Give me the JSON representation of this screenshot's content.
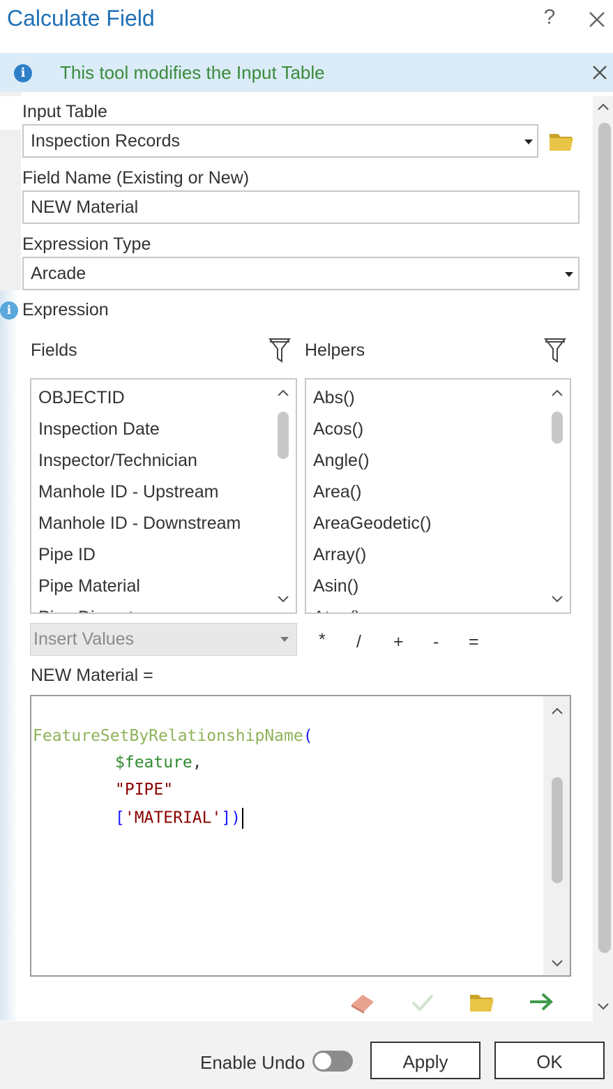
{
  "window": {
    "title": "Calculate Field",
    "help_label": "?"
  },
  "banner": {
    "text": "This tool modifies the Input Table",
    "icon": "info-icon"
  },
  "input_table": {
    "label": "Input Table",
    "value": "Inspection Records"
  },
  "field_name": {
    "label": "Field Name (Existing or New)",
    "value": "NEW Material"
  },
  "expression_type": {
    "label": "Expression Type",
    "value": "Arcade"
  },
  "expression": {
    "label": "Expression",
    "fields_label": "Fields",
    "helpers_label": "Helpers",
    "fields": [
      "OBJECTID",
      "Inspection Date",
      "Inspector/Technician",
      "Manhole ID - Upstream",
      "Manhole ID - Downstream",
      "Pipe ID",
      "Pipe Material",
      "Pipe Diameter"
    ],
    "helpers": [
      "Abs()",
      "Acos()",
      "Angle()",
      "Area()",
      "AreaGeodetic()",
      "Array()",
      "Asin()",
      "Atan()"
    ],
    "insert_values_placeholder": "Insert Values",
    "operators": [
      "*",
      "/",
      "+",
      "-",
      "="
    ],
    "target_label": "NEW Material =",
    "code": {
      "line1_func": "FeatureSetByRelationshipName",
      "line1_paren": "(",
      "line2_var": "$feature",
      "line2_comma": ",",
      "line3_str": "\"PIPE\"",
      "line4_open": "[",
      "line4_str": "'MATERIAL'",
      "line4_close": "])"
    }
  },
  "footer": {
    "enable_undo_label": "Enable Undo",
    "enable_undo_on": false,
    "apply_label": "Apply",
    "ok_label": "OK"
  },
  "colors": {
    "title": "#1f6fb5",
    "banner_bg": "#dbecf8",
    "banner_text": "#3b8a3b",
    "code_function": "#8fb35a",
    "code_variable": "#2e8b2e",
    "code_string": "#8b0000",
    "code_bracket": "#1a1aff"
  }
}
